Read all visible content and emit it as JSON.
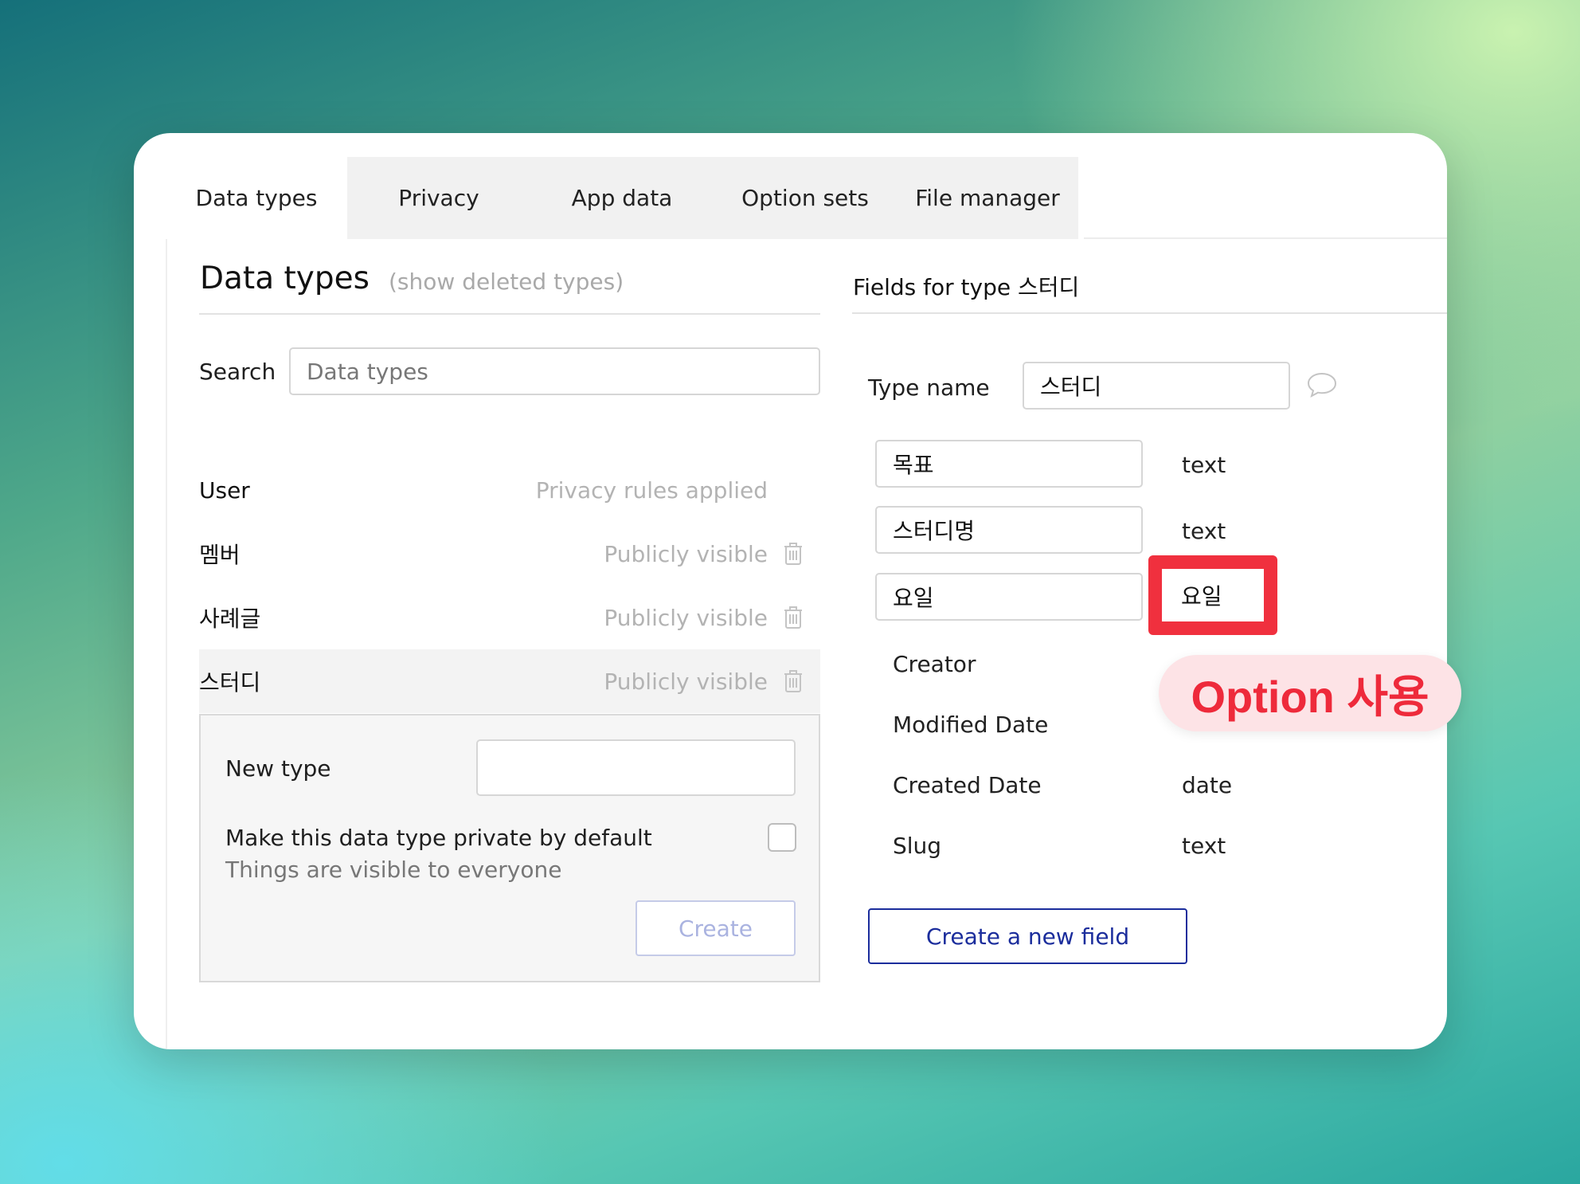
{
  "tabs": [
    {
      "label": "Data types",
      "active": true
    },
    {
      "label": "Privacy",
      "active": false
    },
    {
      "label": "App data",
      "active": false
    },
    {
      "label": "Option sets",
      "active": false
    },
    {
      "label": "File manager",
      "active": false
    }
  ],
  "left": {
    "title": "Data types",
    "show_deleted": "(show deleted types)",
    "search_label": "Search",
    "search_placeholder": "Data types",
    "types": [
      {
        "name": "User",
        "status": "Privacy rules applied"
      },
      {
        "name": "멤버",
        "status": "Publicly visible"
      },
      {
        "name": "사례글",
        "status": "Publicly visible"
      },
      {
        "name": "스터디",
        "status": "Publicly visible"
      }
    ],
    "new_type": {
      "label": "New type",
      "value": "",
      "private_label": "Make this data type private by default",
      "private_hint": "Things are visible to everyone",
      "create_label": "Create"
    }
  },
  "right": {
    "title": "Fields for type 스터디",
    "type_name_label": "Type name",
    "type_name_value": "스터디",
    "editable_fields": [
      {
        "name": "목표",
        "type": "text"
      },
      {
        "name": "스터디명",
        "type": "text"
      },
      {
        "name": "요일",
        "type": "요일"
      }
    ],
    "builtin_fields": [
      {
        "name": "Creator",
        "type": ""
      },
      {
        "name": "Modified Date",
        "type": ""
      },
      {
        "name": "Created Date",
        "type": "date"
      },
      {
        "name": "Slug",
        "type": "text"
      }
    ],
    "create_field_label": "Create a new field"
  },
  "callout": {
    "text": "Option 사용"
  },
  "colors": {
    "highlight": "#f0303e",
    "callout_bg": "#fde3e6",
    "link_blue": "#1b2d9c",
    "muted": "#b3b3b3"
  },
  "icons": [
    "trash-icon",
    "comment-icon"
  ]
}
